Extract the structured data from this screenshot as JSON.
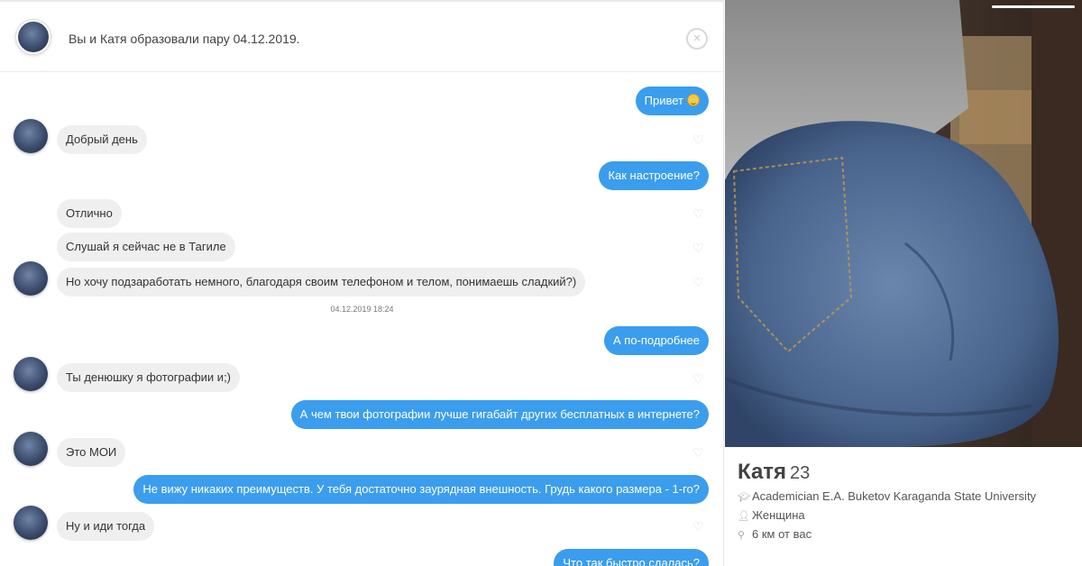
{
  "header": {
    "match_text": "Вы и Катя образовали пару 04.12.2019.",
    "close_icon": "×"
  },
  "messages": [
    {
      "side": "out",
      "text": "Привет",
      "emoji": "smiley"
    },
    {
      "side": "in",
      "text": "Добрый день"
    },
    {
      "side": "out",
      "text": "Как настроение?"
    },
    {
      "side": "in",
      "text": "Отлично"
    },
    {
      "side": "in",
      "text": "Слушай я сейчас не в Тагиле"
    },
    {
      "side": "in",
      "text": "Но хочу подзаработать немного, благодаря своим телефоном и телом, понимаешь сладкий?)"
    },
    {
      "side": "out",
      "text": "А по-подробнее"
    },
    {
      "side": "in",
      "text": "Ты денюшку я фотографии и;)"
    },
    {
      "side": "out",
      "text": "А чем твои фотографии лучше гигабайт других бесплатных в интернете?"
    },
    {
      "side": "in",
      "text": "Это МОИ"
    },
    {
      "side": "out",
      "text": "Не вижу никаких преимуществ. У тебя достаточно заурядная внешность. Грудь какого размера - 1-го?"
    },
    {
      "side": "in",
      "text": "Ну и иди тогда"
    },
    {
      "side": "out",
      "text": "Что так быстро сдалась?"
    }
  ],
  "timestamp": "04.12.2019 18:24",
  "profile": {
    "name": "Катя",
    "age": "23",
    "school": "Academician E.A. Buketov Karaganda State University",
    "gender": "Женщина",
    "distance": "6 км от вас"
  },
  "icons": {
    "heart": "like-heart-icon",
    "school": "graduation-cap-icon",
    "gender": "person-icon",
    "distance": "location-pin-icon"
  },
  "colors": {
    "outgoing_bubble": "#3b9ded",
    "incoming_bubble": "#efefef"
  }
}
